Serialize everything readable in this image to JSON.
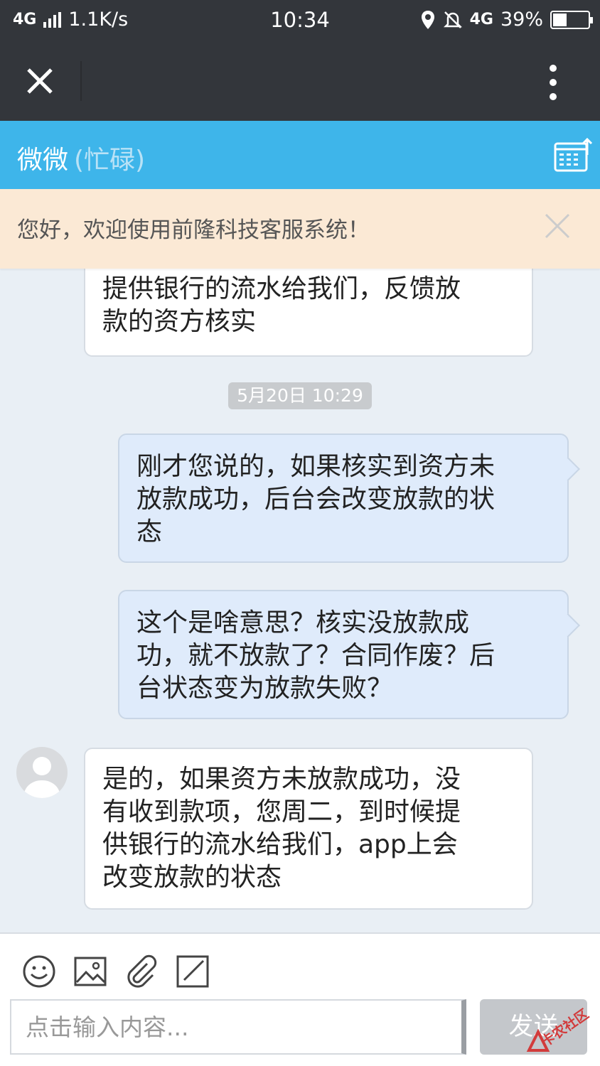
{
  "status_bar": {
    "network": "4G",
    "speed": "1.1K/s",
    "time": "10:34",
    "network2": "4G",
    "battery": "39%",
    "battery_level": 0.39
  },
  "toolbar": {
    "close_icon": "close-icon",
    "more_icon": "more-vertical-icon"
  },
  "chat_header": {
    "name": "微微",
    "status": "(忙碌)",
    "history_icon": "chat-history-icon"
  },
  "notice": {
    "text": "您好，欢迎使用前隆科技客服系统！",
    "close_icon": "close-icon"
  },
  "messages": [
    {
      "from": "agent",
      "lines": [
        "提供银行的流水给我们，反馈放",
        "款的资方核实"
      ]
    },
    {
      "type": "timestamp",
      "text": "5月20日 10:29"
    },
    {
      "from": "me",
      "lines": [
        "刚才您说的，如果核实到资方未",
        "放款成功，后台会改变放款的状",
        "态"
      ]
    },
    {
      "from": "me",
      "lines": [
        "这个是啥意思？核实没放款成",
        "功，就不放款了？合同作废？后",
        "台状态变为放款失败？"
      ]
    },
    {
      "from": "agent",
      "lines": [
        "是的，如果资方未放款成功，没",
        "有收到款项，您周二，到时候提",
        "供银行的流水给我们，app上会",
        "改变放款的状态"
      ]
    }
  ],
  "input": {
    "placeholder": "点击输入内容...",
    "value": "",
    "send_label": "发送",
    "tools": [
      "emoji-icon",
      "image-icon",
      "attachment-icon",
      "edit-icon"
    ]
  },
  "watermark": {
    "text": "卡农社区"
  },
  "colors": {
    "header_blue": "#3eb5ea",
    "dark_bar": "#33363b",
    "notice_bg": "#fbe9d5",
    "outgoing_bubble": "#dfebfb",
    "chat_bg": "#e9eff5"
  }
}
